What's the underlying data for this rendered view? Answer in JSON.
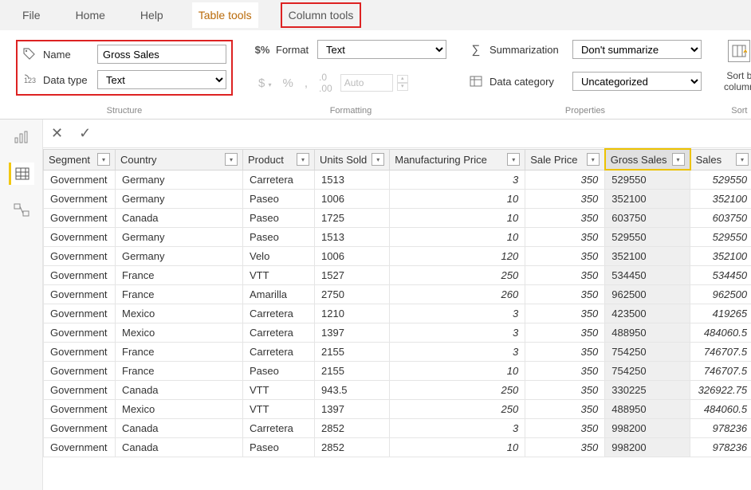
{
  "tabs": {
    "file": "File",
    "home": "Home",
    "help": "Help",
    "tabletools": "Table tools",
    "columntools": "Column tools"
  },
  "structure": {
    "name_label": "Name",
    "name_value": "Gross Sales",
    "datatype_label": "Data type",
    "datatype_value": "Text",
    "group_label": "Structure"
  },
  "formatting": {
    "format_label": "Format",
    "format_value": "Text",
    "auto_placeholder": "Auto",
    "group_label": "Formatting"
  },
  "properties": {
    "summarization_label": "Summarization",
    "summarization_value": "Don't summarize",
    "datacategory_label": "Data category",
    "datacategory_value": "Uncategorized",
    "group_label": "Properties"
  },
  "sort": {
    "label1": "Sort b",
    "label2": "column",
    "group_label": "Sort"
  },
  "columns": [
    "Segment",
    "Country",
    "Product",
    "Units Sold",
    "Manufacturing Price",
    "Sale Price",
    "Gross Sales",
    "Sales"
  ],
  "rows": [
    [
      "Government",
      "Germany",
      "Carretera",
      "1513",
      "3",
      "350",
      "529550",
      "529550"
    ],
    [
      "Government",
      "Germany",
      "Paseo",
      "1006",
      "10",
      "350",
      "352100",
      "352100"
    ],
    [
      "Government",
      "Canada",
      "Paseo",
      "1725",
      "10",
      "350",
      "603750",
      "603750"
    ],
    [
      "Government",
      "Germany",
      "Paseo",
      "1513",
      "10",
      "350",
      "529550",
      "529550"
    ],
    [
      "Government",
      "Germany",
      "Velo",
      "1006",
      "120",
      "350",
      "352100",
      "352100"
    ],
    [
      "Government",
      "France",
      "VTT",
      "1527",
      "250",
      "350",
      "534450",
      "534450"
    ],
    [
      "Government",
      "France",
      "Amarilla",
      "2750",
      "260",
      "350",
      "962500",
      "962500"
    ],
    [
      "Government",
      "Mexico",
      "Carretera",
      "1210",
      "3",
      "350",
      "423500",
      "419265"
    ],
    [
      "Government",
      "Mexico",
      "Carretera",
      "1397",
      "3",
      "350",
      "488950",
      "484060.5"
    ],
    [
      "Government",
      "France",
      "Carretera",
      "2155",
      "3",
      "350",
      "754250",
      "746707.5"
    ],
    [
      "Government",
      "France",
      "Paseo",
      "2155",
      "10",
      "350",
      "754250",
      "746707.5"
    ],
    [
      "Government",
      "Canada",
      "VTT",
      "943.5",
      "250",
      "350",
      "330225",
      "326922.75"
    ],
    [
      "Government",
      "Mexico",
      "VTT",
      "1397",
      "250",
      "350",
      "488950",
      "484060.5"
    ],
    [
      "Government",
      "Canada",
      "Carretera",
      "2852",
      "3",
      "350",
      "998200",
      "978236"
    ],
    [
      "Government",
      "Canada",
      "Paseo",
      "2852",
      "10",
      "350",
      "998200",
      "978236"
    ]
  ]
}
